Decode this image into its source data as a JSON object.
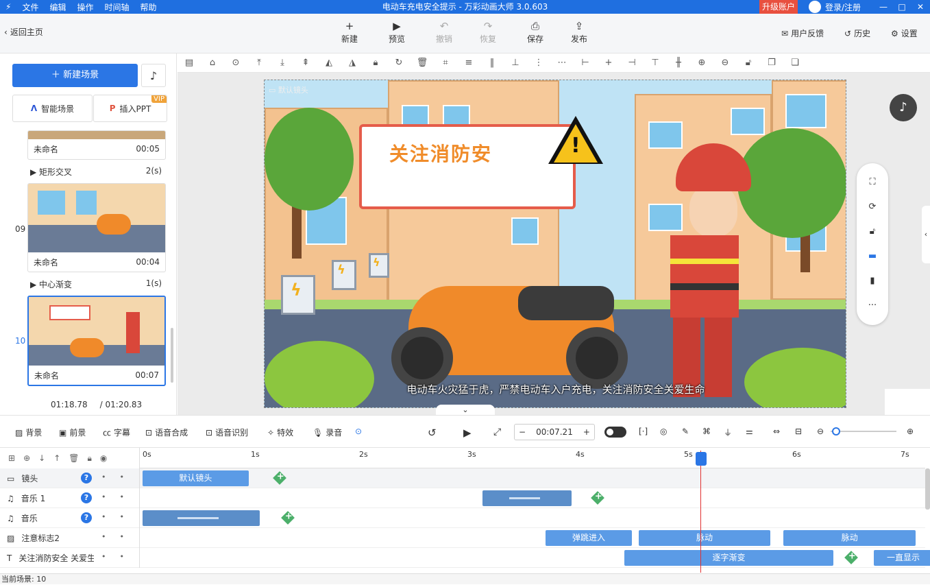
{
  "window": {
    "menu": [
      "文件",
      "编辑",
      "操作",
      "时间轴",
      "帮助"
    ],
    "title": "电动车充电安全提示 - 万彩动画大师 3.0.603",
    "upgrade": "升级账户",
    "login": "登录/注册",
    "controls": [
      "—",
      "□",
      "✕"
    ],
    "brand_color": "#1f6fe0"
  },
  "toolbar": {
    "back": "返回主页",
    "actions": [
      {
        "label": "新建",
        "icon": "+",
        "enabled": true
      },
      {
        "label": "预览",
        "icon": "▶",
        "enabled": true
      },
      {
        "label": "撤销",
        "icon": "↶",
        "enabled": false
      },
      {
        "label": "恢复",
        "icon": "↷",
        "enabled": false
      },
      {
        "label": "保存",
        "icon": "⎙",
        "enabled": true
      },
      {
        "label": "发布",
        "icon": "⇪",
        "enabled": true
      }
    ],
    "right": [
      {
        "label": "用户反馈",
        "icon": "✉"
      },
      {
        "label": "历史",
        "icon": "↺"
      },
      {
        "label": "设置",
        "icon": "⚙"
      }
    ]
  },
  "left_panel": {
    "new_scene": "新建场景",
    "smart_scene": "智能场景",
    "insert_ppt": "插入PPT",
    "vip": "VIP",
    "scenes": [
      {
        "num": "",
        "name": "未命名",
        "duration": "00:05",
        "selected": false
      },
      {
        "num": "09",
        "name": "未命名",
        "duration": "00:04",
        "selected": false
      },
      {
        "num": "10",
        "name": "未命名",
        "duration": "00:07",
        "selected": true
      }
    ],
    "transitions": [
      {
        "name": "矩形交叉",
        "duration": "2(s)"
      },
      {
        "name": "中心渐变",
        "duration": "1(s)"
      }
    ],
    "current_time": "01:18.78",
    "total_time": "/ 01:20.83"
  },
  "stage": {
    "camera_label": "默认镜头",
    "sign_text": "关注消防安",
    "warning": "!",
    "subtitle": "电动车火灾猛于虎，严禁电动车入户充电，关注消防安全关爱生命"
  },
  "timeline_toolbar": {
    "items": [
      "背景",
      "前景",
      "字幕",
      "语音合成",
      "语音识别",
      "特效",
      "录音"
    ],
    "time": "00:07.21",
    "minus": "−",
    "plus": "+"
  },
  "timeline": {
    "ticks": [
      "0s",
      "1s",
      "2s",
      "3s",
      "4s",
      "5s",
      "6s",
      "7s"
    ],
    "playhead_seconds": 5.15,
    "tracks": [
      {
        "name": "镜头",
        "icon": "camera-icon",
        "help": "?",
        "clips": [
          {
            "label": "默认镜头",
            "start": 0,
            "end": 0.98
          }
        ],
        "add_at": 1.22
      },
      {
        "name": "音乐 1",
        "icon": "music-note-icon",
        "help": "?",
        "audio": [
          {
            "start": 3.14,
            "end": 3.96
          }
        ],
        "add_at": 4.16
      },
      {
        "name": "音乐",
        "icon": "music-note-icon",
        "help": "?",
        "audio": [
          {
            "start": 0,
            "end": 1.08
          }
        ],
        "add_at": 1.3
      },
      {
        "name": "注意标志2",
        "icon": "image-icon",
        "clips": [
          {
            "label": "弹跳进入",
            "start": 3.72,
            "end": 4.52
          },
          {
            "label": "脉动",
            "start": 4.58,
            "end": 5.8
          },
          {
            "label": "脉动",
            "start": 5.92,
            "end": 7.14
          }
        ]
      },
      {
        "name": "关注消防安全 关爱生命",
        "icon": "text-icon",
        "clips": [
          {
            "label": "逐字渐变",
            "start": 4.45,
            "end": 6.38
          },
          {
            "label": "一直显示",
            "start": 6.75,
            "end": 7.3
          }
        ],
        "add_at": 6.5
      }
    ]
  },
  "status": "当前场景: 10"
}
